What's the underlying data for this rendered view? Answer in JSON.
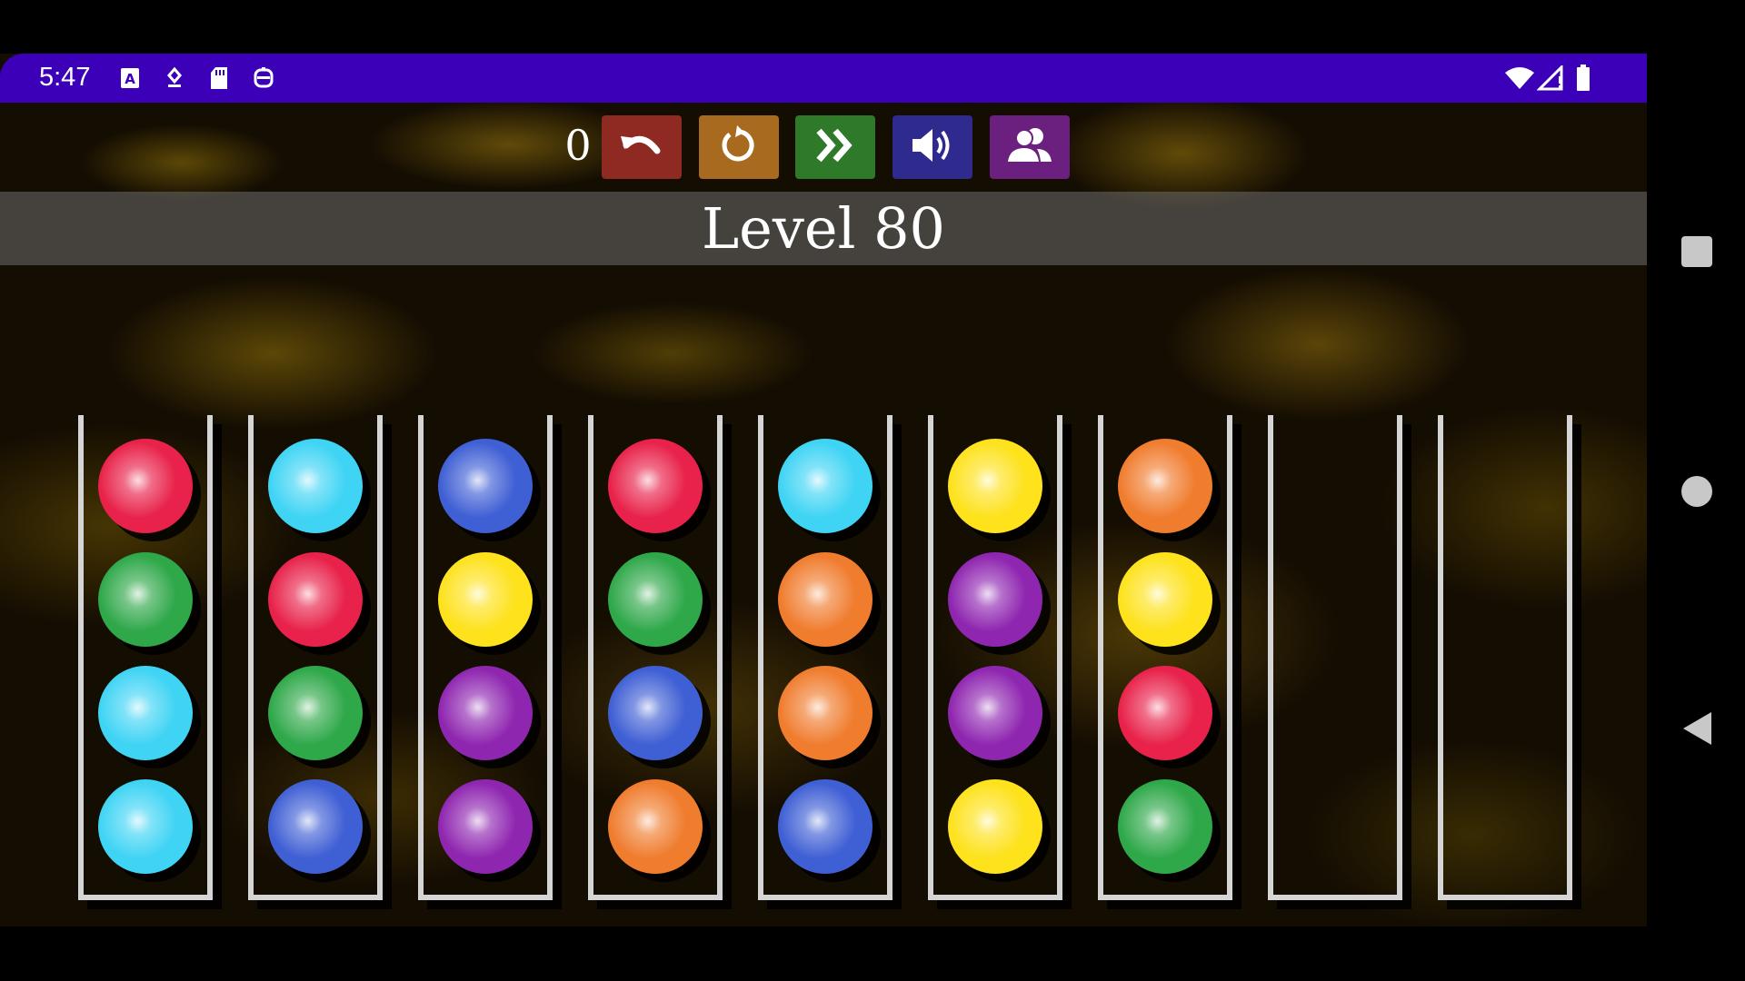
{
  "status_bar": {
    "time": "5:47",
    "left_icons": [
      "a-badge-icon",
      "location-pin-icon",
      "sd-card-icon",
      "robot-face-icon"
    ],
    "right_icons": [
      "wifi-icon",
      "cell-signal-icon",
      "battery-icon"
    ]
  },
  "toolbar": {
    "move_count": "0",
    "buttons": [
      "undo-icon",
      "restart-icon",
      "skip-level-icon",
      "sound-icon",
      "players-icon"
    ]
  },
  "level": {
    "title": "Level 80"
  },
  "colors": {
    "red": "#e8224a",
    "cyan": "#3fd4f4",
    "green": "#2fa84a",
    "blue": "#3f5fd4",
    "yellow": "#fde21c",
    "purple": "#8f26b0",
    "orange": "#f07c2e"
  },
  "tubes": [
    [
      "red",
      "green",
      "cyan",
      "cyan"
    ],
    [
      "cyan",
      "red",
      "green",
      "blue"
    ],
    [
      "blue",
      "yellow",
      "purple",
      "purple"
    ],
    [
      "red",
      "green",
      "blue",
      "orange"
    ],
    [
      "cyan",
      "orange",
      "orange",
      "blue"
    ],
    [
      "yellow",
      "purple",
      "purple",
      "yellow"
    ],
    [
      "orange",
      "yellow",
      "red",
      "green"
    ],
    [],
    []
  ],
  "nav_bar": [
    "recents-square-icon",
    "home-circle-icon",
    "back-triangle-icon"
  ]
}
